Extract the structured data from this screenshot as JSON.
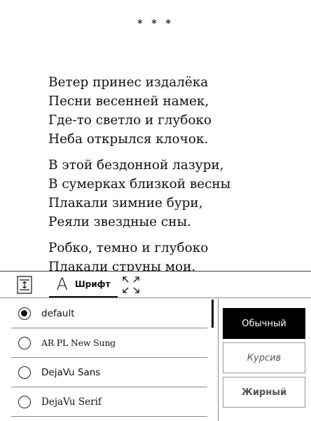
{
  "reader": {
    "separator": "* * *",
    "stanzas": [
      [
        "Ветер принес издалёка",
        "Песни весенней намек,",
        "Где-то светло и глубоко",
        "Неба открылся клочок."
      ],
      [
        "В этой бездонной лазури,",
        "В сумерках близкой весны",
        "Плакали зимние бури,",
        "Реяли звездные сны."
      ],
      [
        "Робко, темно и глубоко",
        "Плакали струны мои."
      ]
    ]
  },
  "toolbar": {
    "spacing_icon": "line-spacing-icon",
    "font_icon": "font-letter-icon",
    "font_glyph": "A",
    "font_tab_label": "Шрифт",
    "fullscreen_icon": "fullscreen-icon"
  },
  "font_list": {
    "items": [
      {
        "name": "default",
        "selected": true
      },
      {
        "name": "AR PL New Sung",
        "selected": false
      },
      {
        "name": "DejaVu Sans",
        "selected": false
      },
      {
        "name": "DejaVu Serif",
        "selected": false
      }
    ]
  },
  "styles": {
    "normal": "Обычный",
    "italic": "Курсив",
    "bold": "Жирный",
    "active": "normal"
  }
}
